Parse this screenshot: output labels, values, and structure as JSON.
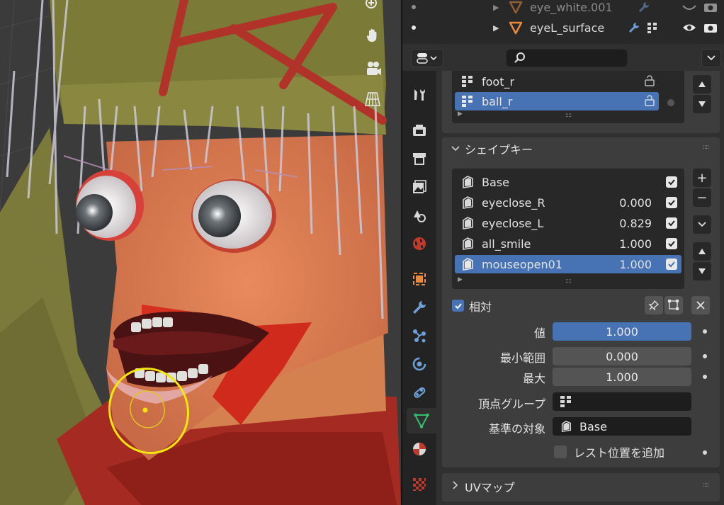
{
  "outliner": {
    "rows": [
      {
        "name": "eye_white.001"
      },
      {
        "name": "eyeL_surface"
      }
    ]
  },
  "bone_groups": {
    "items": [
      {
        "name": "foot_r"
      },
      {
        "name": "ball_r"
      }
    ]
  },
  "shape_keys": {
    "title": "シェイプキー",
    "items": [
      {
        "name": "Base",
        "value": ""
      },
      {
        "name": "eyeclose_R",
        "value": "0.000"
      },
      {
        "name": "eyeclose_L",
        "value": "0.829"
      },
      {
        "name": "all_smile",
        "value": "1.000"
      },
      {
        "name": "mouseopen01",
        "value": "1.000"
      }
    ],
    "relative_label": "相対",
    "value_label": "値",
    "value": "1.000",
    "range_min_label": "最小範囲",
    "range_min": "0.000",
    "max_label": "最大",
    "max": "1.000",
    "vertex_group_label": "頂点グループ",
    "relative_to_label": "基準の対象",
    "relative_to": "Base",
    "add_rest_label": "レスト位置を追加"
  },
  "uv_maps": {
    "title": "UVマップ"
  },
  "colors": {
    "accent": "#4772b3",
    "panel": "#3d3d3d",
    "mesh_orange": "#e8893b"
  }
}
